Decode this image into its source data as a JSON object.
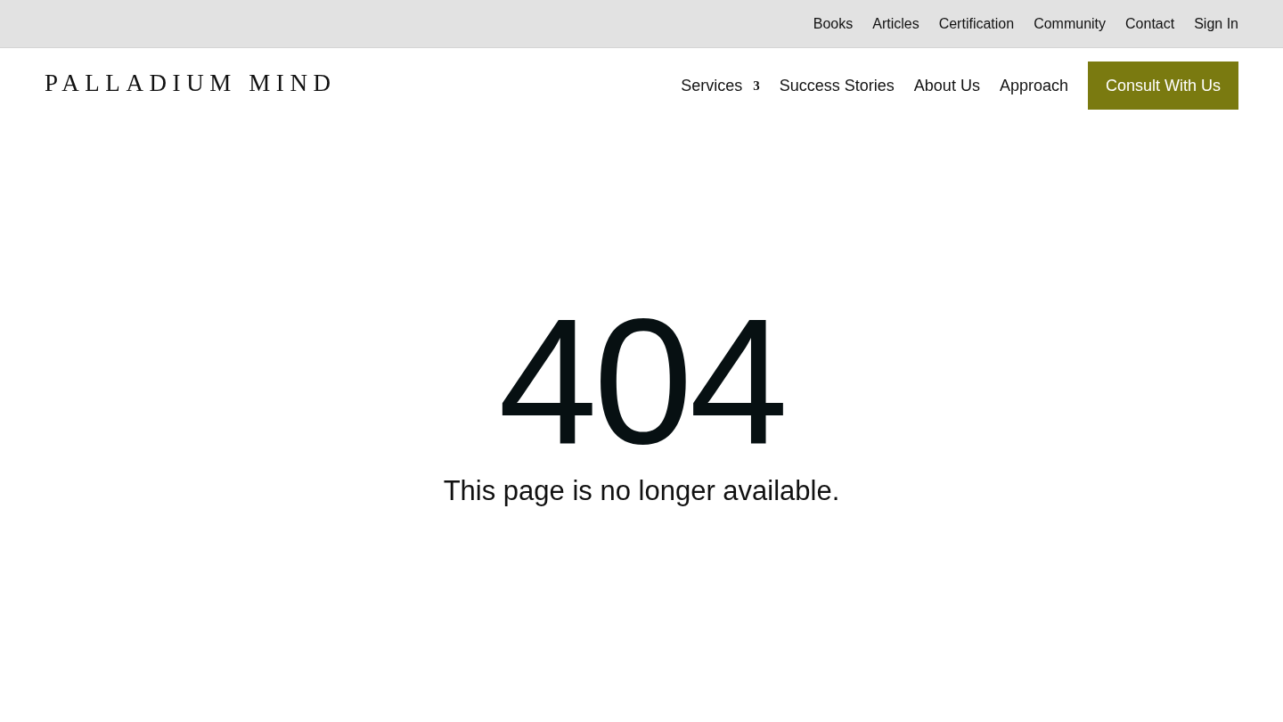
{
  "top_bar": {
    "links": [
      "Books",
      "Articles",
      "Certification",
      "Community",
      "Contact",
      "Sign In"
    ]
  },
  "header": {
    "logo": "PALLADIUM MIND",
    "nav": [
      {
        "label": "Services",
        "dropdown_glyph": "3"
      },
      {
        "label": "Success Stories"
      },
      {
        "label": "About Us"
      },
      {
        "label": "Approach"
      }
    ],
    "cta": "Consult With Us"
  },
  "error": {
    "code": "404",
    "message": "This page is no longer available."
  }
}
